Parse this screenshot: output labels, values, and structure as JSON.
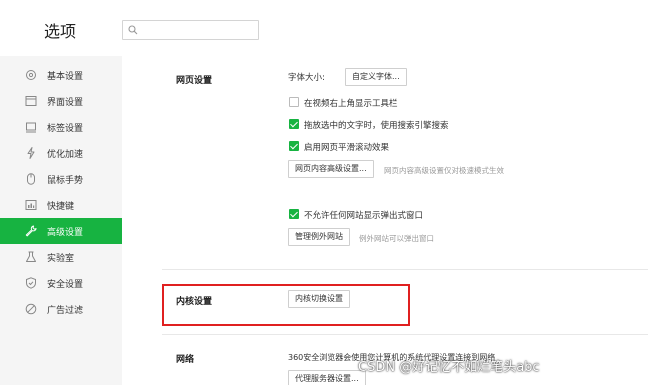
{
  "header": {
    "title": "选项",
    "search_placeholder": ""
  },
  "sidebar": {
    "items": [
      {
        "label": "基本设置",
        "icon": "gear-icon",
        "active": false
      },
      {
        "label": "界面设置",
        "icon": "window-icon",
        "active": false
      },
      {
        "label": "标签设置",
        "icon": "tab-icon",
        "active": false
      },
      {
        "label": "优化加速",
        "icon": "lightning-icon",
        "active": false
      },
      {
        "label": "鼠标手势",
        "icon": "mouse-icon",
        "active": false
      },
      {
        "label": "快捷键",
        "icon": "keyboard-icon",
        "active": false
      },
      {
        "label": "高级设置",
        "icon": "wrench-icon",
        "active": true
      },
      {
        "label": "实验室",
        "icon": "flask-icon",
        "active": false
      },
      {
        "label": "安全设置",
        "icon": "shield-icon",
        "active": false
      },
      {
        "label": "广告过滤",
        "icon": "block-icon",
        "active": false
      }
    ]
  },
  "web_settings": {
    "title": "网页设置",
    "font_size_label": "字体大小:",
    "custom_font_button": "自定义字体...",
    "options": [
      {
        "label": "在视频右上角显示工具栏",
        "checked": false
      },
      {
        "label": "拖放选中的文字时，使用搜索引擎搜索",
        "checked": true
      },
      {
        "label": "启用网页平滑滚动效果",
        "checked": true
      }
    ],
    "advanced_button": "网页内容高级设置...",
    "advanced_hint": "网页内容高级设置仅对极速模式生效",
    "popup_option": {
      "label": "不允许任何网站显示弹出式窗口",
      "checked": true
    },
    "exceptions_button": "管理例外网站",
    "exceptions_hint": "例外网站可以弹出窗口"
  },
  "kernel_settings": {
    "title": "内核设置",
    "switch_button": "内核切换设置"
  },
  "network": {
    "title": "网络",
    "description": "360安全浏览器会使用您计算机的系统代理设置连接到网络",
    "proxy_button": "代理服务器设置..."
  },
  "watermark": "CSDN @好记忆不如烂笔头abc",
  "colors": {
    "accent": "#17b341",
    "highlight_box": "#e02020"
  }
}
